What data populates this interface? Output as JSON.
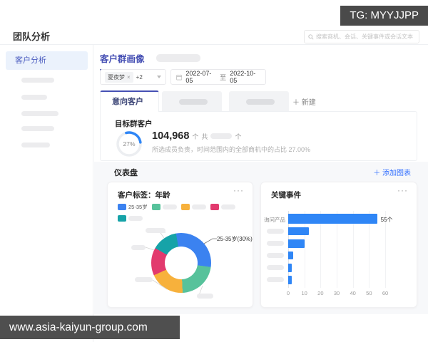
{
  "overlays": {
    "tg_badge": "TG: MYYJJPP",
    "watermark": "www.asia-kaiyun-group.com"
  },
  "header": {
    "title": "团队分析",
    "search_placeholder": "搜索商机、会话、关键事件或会话文本"
  },
  "sidebar": {
    "active_item": "客户分析"
  },
  "main": {
    "page_tab": "客户群画像",
    "filters": {
      "group_tag": "夏夜梦",
      "tag_close": "×",
      "more_count": "+2",
      "date_start": "2022-07-05",
      "date_to": "至",
      "date_end": "2022-10-05"
    },
    "tabs": {
      "active": "意向客户",
      "new_button": "＋ 新建"
    },
    "stats": {
      "title": "目标群客户",
      "gauge_percent": "27%",
      "gauge_value": 27,
      "value": "104,968",
      "unit": "个",
      "total_prefix": "共",
      "total_unit": "个",
      "description": "所选成员负责，时间范围内的全部商机中的占比 27.00%"
    },
    "dashboard": {
      "title": "仪表盘",
      "add_chart": "＋ 添加图表"
    }
  },
  "chart_data": [
    {
      "type": "pie",
      "donut": true,
      "title": "客户标签：年龄",
      "menu": "···",
      "categories": [
        "25-35岁",
        "",
        "",
        "",
        ""
      ],
      "values": [
        30,
        22,
        19,
        15,
        14
      ],
      "colors": [
        "#3b82f0",
        "#57c29b",
        "#f7b13c",
        "#e23a6e",
        "#16a3a8"
      ],
      "visible_label": "25-35岁(30%)",
      "legend": [
        "25-35岁",
        "",
        "",
        "",
        ""
      ],
      "legend_position": "top"
    },
    {
      "type": "bar",
      "orientation": "horizontal",
      "title": "关键事件",
      "menu": "···",
      "categories": [
        "询问产品",
        "",
        "",
        "",
        "",
        ""
      ],
      "values": [
        55,
        13,
        10,
        3,
        2,
        2
      ],
      "value_label": "55个",
      "bar_color": "#2f86f6",
      "xticks": [
        0,
        10,
        20,
        30,
        40,
        50,
        60
      ],
      "xlim": [
        0,
        65
      ],
      "grid": true
    }
  ]
}
